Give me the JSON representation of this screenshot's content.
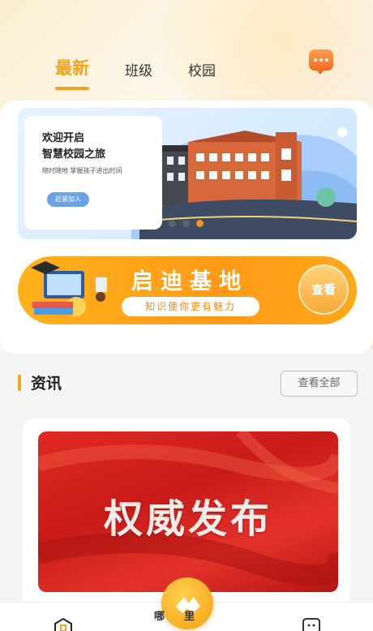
{
  "header": {
    "tabs": [
      {
        "label": "最新",
        "active": true
      },
      {
        "label": "班级",
        "active": false
      },
      {
        "label": "校园",
        "active": false
      }
    ],
    "chat_icon": "chat-bubble-icon",
    "accent_color": "#f4a31a"
  },
  "banner": {
    "title_line1": "欢迎开启",
    "title_line2": "智慧校园之旅",
    "subtitle": "随时随地 掌握孩子进出时间",
    "join_label": "赶紧加入",
    "dots": 3,
    "active_dot": 2
  },
  "base_banner": {
    "title": "启迪基地",
    "slogan": "知识使你更有魅力",
    "view_label": "查看"
  },
  "news_section": {
    "title": "资讯",
    "view_all_label": "查看全部",
    "news_image_title": "权威发布"
  },
  "bottom_nav": {
    "home_icon": "home-icon",
    "center_label": "哪里",
    "message_icon": "message-icon"
  }
}
